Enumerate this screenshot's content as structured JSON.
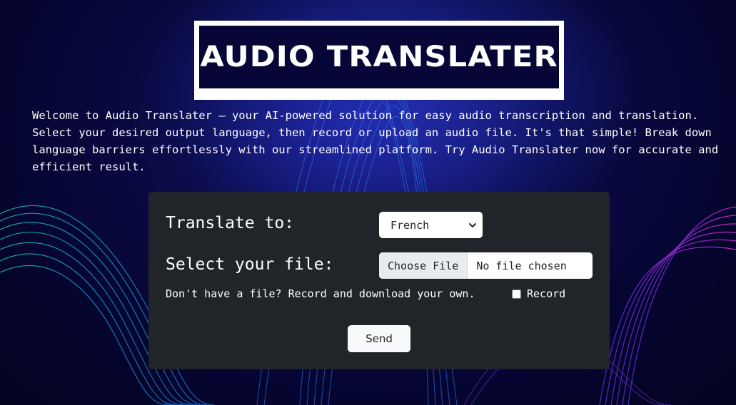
{
  "header": {
    "logo_text": "AUDIO TRANSLATER"
  },
  "intro": {
    "text": "Welcome to Audio Translater — your AI-powered solution for easy audio transcription and translation. Select your desired output language, then record or upload an audio file. It's that simple! Break down language barriers effortlessly with our streamlined platform. Try Audio Translater now for accurate and efficient result."
  },
  "form": {
    "translate_label": "Translate to:",
    "language_selected": "French",
    "file_label": "Select your file:",
    "choose_file_label": "Choose File",
    "no_file_text": "No file chosen",
    "record_hint": "Don't have a file? Record and download your own.",
    "record_label": "Record",
    "record_checked": false,
    "send_label": "Send"
  },
  "colors": {
    "panel_bg": "#212529",
    "background_dark": "#050530",
    "logo_bg": "#060637",
    "accent_teal": "#1fb5a8",
    "accent_magenta": "#c02ad6"
  },
  "icons": {
    "select_chevron": "chevron-down-icon"
  }
}
